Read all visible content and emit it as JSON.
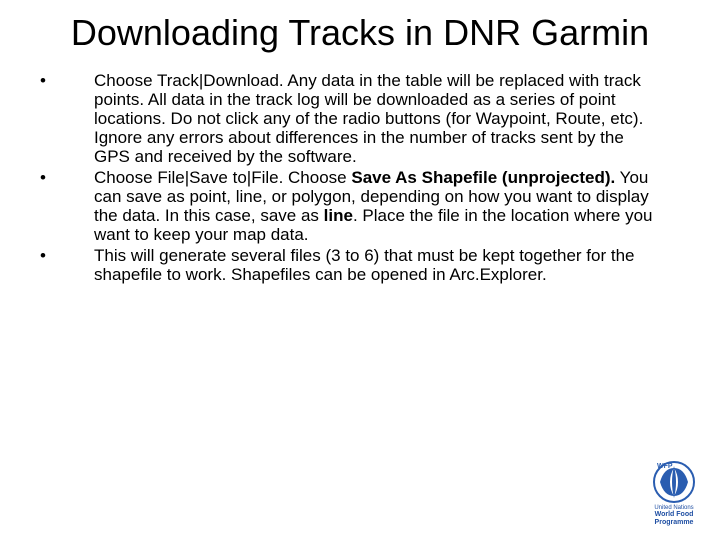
{
  "title": "Downloading Tracks in DNR Garmin",
  "bullets": [
    {
      "marker": "•",
      "html": "Choose Track|Download.  Any data in the table will be replaced with track points.  All data in the track log will be downloaded as a series of point locations.  Do not click any of the radio buttons (for Waypoint, Route, etc).  Ignore any errors about differences in the number of tracks sent by the GPS and received by the software."
    },
    {
      "marker": "•",
      "html": "Choose File|Save to|File.  Choose <b>Save As Shapefile (unprojected).</b>  You can save as point, line, or polygon, depending on how you want to display the data. In this case, save as <b>line</b>. Place the file in the location where you want to keep your map data."
    },
    {
      "marker": "•",
      "html": "This will generate several files (3 to 6) that must be kept together for the shapefile to work.  Shapefiles can be opened in Arc.Explorer."
    }
  ],
  "logo": {
    "abbr": "WFP",
    "line1": "United Nations",
    "line2": "World Food",
    "line3": "Programme",
    "color": "#2a5db0"
  }
}
